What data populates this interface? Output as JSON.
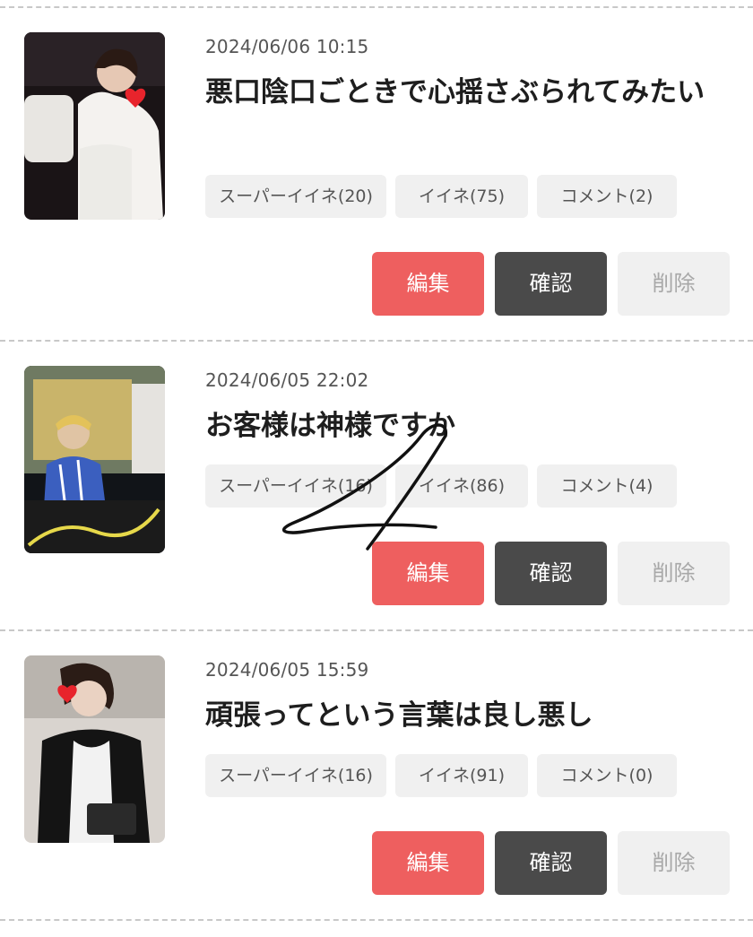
{
  "posts": [
    {
      "date": "2024/06/06 10:15",
      "title": "悪口陰口ごときで心揺さぶられてみたい",
      "super_like": "スーパーイイネ(20)",
      "like": "イイネ(75)",
      "comment": "コメント(2)",
      "edit": "編集",
      "confirm": "確認",
      "delete": "削除"
    },
    {
      "date": "2024/06/05 22:02",
      "title": "お客様は神様ですか",
      "super_like": "スーパーイイネ(16)",
      "like": "イイネ(86)",
      "comment": "コメント(4)",
      "edit": "編集",
      "confirm": "確認",
      "delete": "削除"
    },
    {
      "date": "2024/06/05 15:59",
      "title": "頑張ってという言葉は良し悪し",
      "super_like": "スーパーイイネ(16)",
      "like": "イイネ(91)",
      "comment": "コメント(0)",
      "edit": "編集",
      "confirm": "確認",
      "delete": "削除"
    }
  ],
  "colors": {
    "edit_button": "#ee5f5f",
    "confirm_button": "#4a4a4a",
    "delete_button": "#f0f0f0",
    "tag_background": "#f0f0f0",
    "divider": "#c8c8c8"
  }
}
